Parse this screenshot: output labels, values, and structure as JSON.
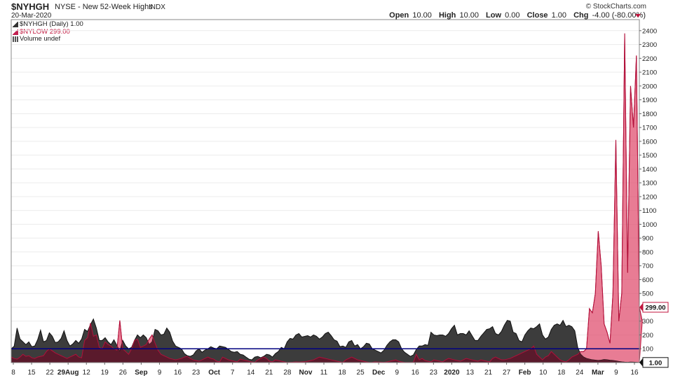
{
  "header": {
    "symbol": "$NYHGH",
    "description": "NYSE - New 52-Week Highs",
    "exchange": "INDX",
    "date": "20-Mar-2020",
    "brand": "© StockCharts.com",
    "open_label": "Open",
    "open": "10.00",
    "high_label": "High",
    "high": "10.00",
    "low_label": "Low",
    "low": "0.00",
    "close_label": "Close",
    "close": "1.00",
    "chg_label": "Chg",
    "chg": "-4.00 (-80.00%)"
  },
  "legend": {
    "primary": "$NYHGH (Daily) 1.00",
    "secondary": "$NYLOW 299.00",
    "volume": "Volume undef"
  },
  "colors": {
    "highs_fill": "#3c3c3c",
    "lows_fill": "#e05070",
    "overlap_fill": "#5a1a2c",
    "reference_line": "#000080"
  },
  "chart_data": {
    "type": "area",
    "x_tick_labels": [
      "8",
      "15",
      "22",
      "29Aug",
      "12",
      "19",
      "26",
      "Sep",
      "9",
      "16",
      "23",
      "Oct",
      "7",
      "14",
      "21",
      "28",
      "Nov",
      "11",
      "18",
      "25",
      "Dec",
      "9",
      "16",
      "23",
      "2020",
      "13",
      "21",
      "27",
      "Feb",
      "10",
      "18",
      "24",
      "Mar",
      "9",
      "16"
    ],
    "y_ticks": [
      100,
      200,
      300,
      400,
      500,
      600,
      700,
      800,
      900,
      1000,
      1100,
      1200,
      1300,
      1400,
      1500,
      1600,
      1700,
      1800,
      1900,
      2000,
      2100,
      2200,
      2300,
      2400
    ],
    "ylim": [
      0,
      2480
    ],
    "reference_line": 100,
    "last_value_labels": [
      "299.00",
      "1.00"
    ],
    "series": [
      {
        "name": "$NYHGH",
        "values": [
          100,
          118,
          250,
          170,
          150,
          130,
          150,
          115,
          120,
          165,
          235,
          150,
          160,
          215,
          190,
          145,
          150,
          175,
          230,
          160,
          120,
          135,
          160,
          140,
          170,
          240,
          225,
          275,
          315,
          250,
          160,
          160,
          180,
          150,
          130,
          165,
          125,
          80,
          160,
          120,
          100,
          110,
          160,
          200,
          180,
          200,
          180,
          130,
          150,
          240,
          230,
          200,
          205,
          250,
          220,
          155,
          120,
          110,
          100,
          65,
          50,
          45,
          55,
          85,
          100,
          75,
          90,
          100,
          115,
          105,
          100,
          120,
          115,
          110,
          95,
          80,
          75,
          80,
          60,
          55,
          40,
          25,
          20,
          40,
          45,
          35,
          45,
          60,
          55,
          40,
          65,
          80,
          110,
          100,
          150,
          175,
          170,
          200,
          210,
          185,
          190,
          195,
          185,
          200,
          190,
          170,
          185,
          210,
          220,
          195,
          165,
          155,
          115,
          120,
          110,
          150,
          160,
          120,
          130,
          100,
          115,
          140,
          135,
          100,
          90,
          80,
          70,
          90,
          125,
          150,
          165,
          165,
          150,
          100,
          75,
          60,
          45,
          55,
          95,
          120,
          120,
          130,
          125,
          220,
          200,
          195,
          200,
          200,
          190,
          210,
          245,
          270,
          200,
          210,
          210,
          200,
          230,
          195,
          160,
          160,
          190,
          215,
          240,
          245,
          260,
          210,
          200,
          225,
          270,
          305,
          300,
          220,
          210,
          160,
          150,
          200,
          230,
          250,
          245,
          260,
          280,
          200,
          170,
          185,
          240,
          270,
          280,
          270,
          305,
          260,
          270,
          260,
          230,
          110,
          60,
          40,
          30,
          25,
          20,
          18,
          15,
          18,
          22,
          20,
          17,
          15,
          12,
          8,
          5,
          3,
          2,
          4,
          3,
          2,
          1
        ]
      },
      {
        "name": "$NYLOW",
        "values": [
          40,
          30,
          25,
          40,
          60,
          45,
          50,
          35,
          30,
          40,
          45,
          50,
          80,
          100,
          85,
          70,
          60,
          50,
          40,
          30,
          40,
          50,
          60,
          40,
          35,
          160,
          180,
          285,
          190,
          200,
          110,
          100,
          150,
          130,
          120,
          100,
          90,
          305,
          100,
          80,
          60,
          100,
          160,
          170,
          110,
          120,
          130,
          170,
          200,
          140,
          90,
          60,
          50,
          40,
          30,
          25,
          20,
          25,
          30,
          40,
          45,
          30,
          20,
          15,
          10,
          20,
          30,
          40,
          30,
          25,
          10,
          5,
          40,
          30,
          20,
          15,
          10,
          5,
          25,
          20,
          15,
          10,
          5,
          2,
          20,
          30,
          40,
          30,
          10,
          5,
          20,
          15,
          10,
          5,
          1,
          2,
          3,
          5,
          4,
          5,
          6,
          10,
          15,
          20,
          30,
          40,
          35,
          30,
          25,
          20,
          15,
          10,
          5,
          1,
          20,
          30,
          40,
          30,
          20,
          15,
          10,
          5,
          1,
          2,
          5,
          4,
          3,
          2,
          5,
          10,
          15,
          20,
          10,
          5,
          2,
          1,
          1,
          1,
          60,
          20,
          30,
          15,
          10,
          5,
          20,
          15,
          10,
          5,
          20,
          30,
          25,
          20,
          15,
          10,
          20,
          30,
          25,
          20,
          15,
          10,
          20,
          15,
          10,
          5,
          30,
          40,
          30,
          20,
          20,
          25,
          30,
          40,
          50,
          60,
          70,
          80,
          90,
          100,
          120,
          60,
          40,
          20,
          40,
          50,
          80,
          60,
          40,
          20,
          10,
          5,
          20,
          40,
          50,
          60,
          80,
          80,
          100,
          390,
          360,
          500,
          950,
          700,
          280,
          220,
          140,
          500,
          1610,
          300,
          500,
          2380,
          650,
          2000,
          1700,
          2220,
          400,
          299
        ]
      }
    ]
  }
}
